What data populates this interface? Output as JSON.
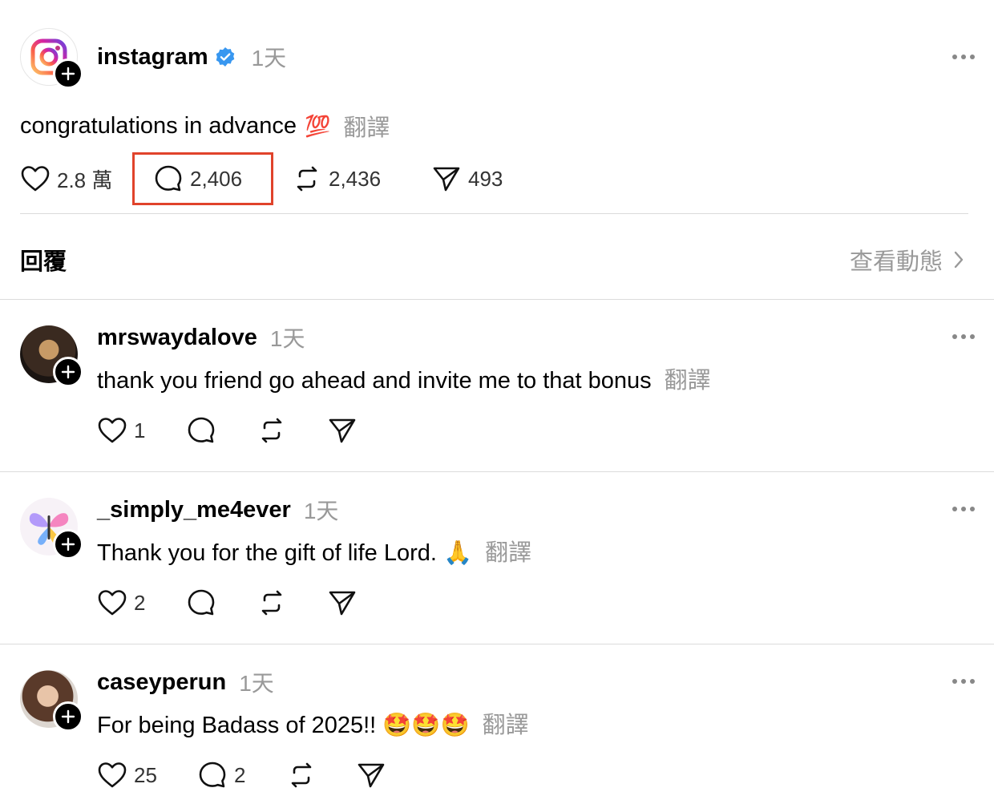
{
  "post": {
    "username": "instagram",
    "time": "1天",
    "text": "congratulations in advance",
    "emoji": "💯",
    "translate": "翻譯",
    "likes": "2.8 萬",
    "comments": "2,406",
    "reposts": "2,436",
    "shares": "493"
  },
  "replies_header": {
    "title": "回覆",
    "view_activity": "查看動態"
  },
  "highlight_color": "#e0432b",
  "comments": [
    {
      "username": "mrswaydalove",
      "time": "1天",
      "text": "thank you friend go ahead and invite me to that bonus",
      "translate": "翻譯",
      "likes": "1",
      "replies": ""
    },
    {
      "username": "_simply_me4ever",
      "time": "1天",
      "text": "Thank you for the gift of life Lord. 🙏",
      "translate": "翻譯",
      "likes": "2",
      "replies": ""
    },
    {
      "username": "caseyperun",
      "time": "1天",
      "text": "For being Badass of 2025!! 🤩🤩🤩",
      "translate": "翻譯",
      "likes": "25",
      "replies": "2"
    }
  ]
}
